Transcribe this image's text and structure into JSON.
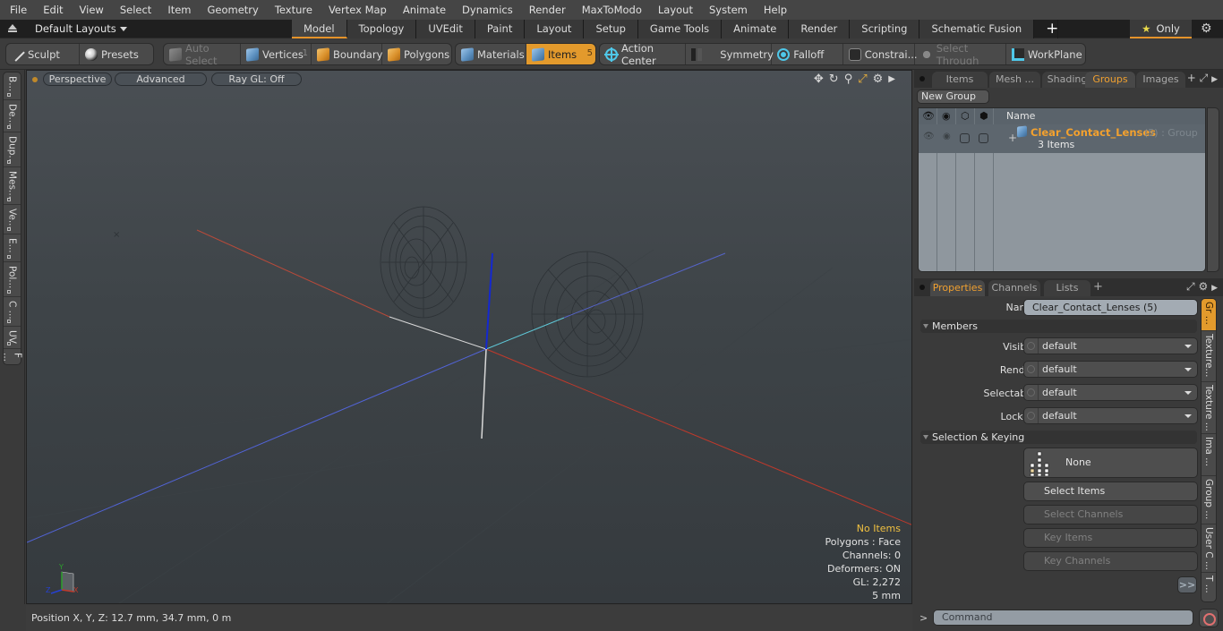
{
  "menu": [
    "File",
    "Edit",
    "View",
    "Select",
    "Item",
    "Geometry",
    "Texture",
    "Vertex Map",
    "Animate",
    "Dynamics",
    "Render",
    "MaxToModo",
    "Layout",
    "System",
    "Help"
  ],
  "layout_bar": {
    "layouts_label": "Default Layouts",
    "tabs": [
      "Model",
      "Topology",
      "UVEdit",
      "Paint",
      "Layout",
      "Setup",
      "Game Tools",
      "Animate",
      "Render",
      "Scripting",
      "Schematic Fusion"
    ],
    "active_tab": "Model",
    "add_tab": "+",
    "only_label": "Only"
  },
  "toolbar": {
    "sculpt": "Sculpt",
    "presets": "Presets",
    "auto_select": "Auto Select",
    "vertices": "Vertices",
    "vertices_count": "1",
    "boundary": "Boundary",
    "polygons": "Polygons",
    "materials": "Materials",
    "items": "Items",
    "items_count": "5",
    "action_center": "Action Center",
    "symmetry": "Symmetry",
    "falloff": "Falloff",
    "constraints": "Constrai...",
    "select_through": "Select Through",
    "workplane": "WorkPlane"
  },
  "left_tabs": [
    "B...",
    "De...",
    "Dup...",
    "Mes...",
    "Ve...",
    "E...",
    "Pol...",
    "C ...",
    "UV",
    "F ..."
  ],
  "viewport": {
    "view_mode": "Perspective",
    "shading": "Advanced",
    "raygl": "Ray GL: Off",
    "info": {
      "selection": "No Items",
      "polygons": "Polygons : Face",
      "channels": "Channels: 0",
      "deformers": "Deformers: ON",
      "gl": "GL: 2,272",
      "scale": "5 mm"
    },
    "axes": {
      "x": "X",
      "y": "Y",
      "z": "Z"
    },
    "colors": {
      "x_axis": "#c0392b",
      "z_axis": "#4a5fd0",
      "y_axis": "#1020c8",
      "warn": "#f0c040"
    }
  },
  "status_bar": {
    "position": "Position X, Y, Z:   12.7 mm, 34.7 mm, 0 m"
  },
  "groups_panel": {
    "tabs": [
      "Items",
      "Mesh ...",
      "Shading",
      "Groups",
      "Images"
    ],
    "active_tab": "Groups",
    "new_group": "New Group",
    "column_name": "Name",
    "rows": [
      {
        "name": "Clear_Contact_Lenses",
        "meta": "(5) : Group",
        "sub": "3 Items"
      }
    ]
  },
  "properties_panel": {
    "tabs": [
      "Properties",
      "Channels",
      "Lists"
    ],
    "active_tab": "Properties",
    "name_label": "Name",
    "name_value": "Clear_Contact_Lenses (5)",
    "members_section": "Members",
    "fields": [
      {
        "label": "Visible",
        "value": "default"
      },
      {
        "label": "Render",
        "value": "default"
      },
      {
        "label": "Selectable",
        "value": "default"
      },
      {
        "label": "Locked",
        "value": "default"
      }
    ],
    "selection_section": "Selection & Keying",
    "none_button": "None",
    "select_items": "Select Items",
    "select_channels": "Select Channels",
    "key_items": "Key Items",
    "key_channels": "Key Channels",
    "more": ">>",
    "side_tabs": [
      "Gr ...",
      "Texture...",
      "Texture ...",
      "Ima ...",
      "Group ...",
      "User C ...",
      "T ..."
    ]
  },
  "command_bar": {
    "prompt": ">",
    "placeholder": "Command"
  },
  "accent_color": "#e39a2c"
}
